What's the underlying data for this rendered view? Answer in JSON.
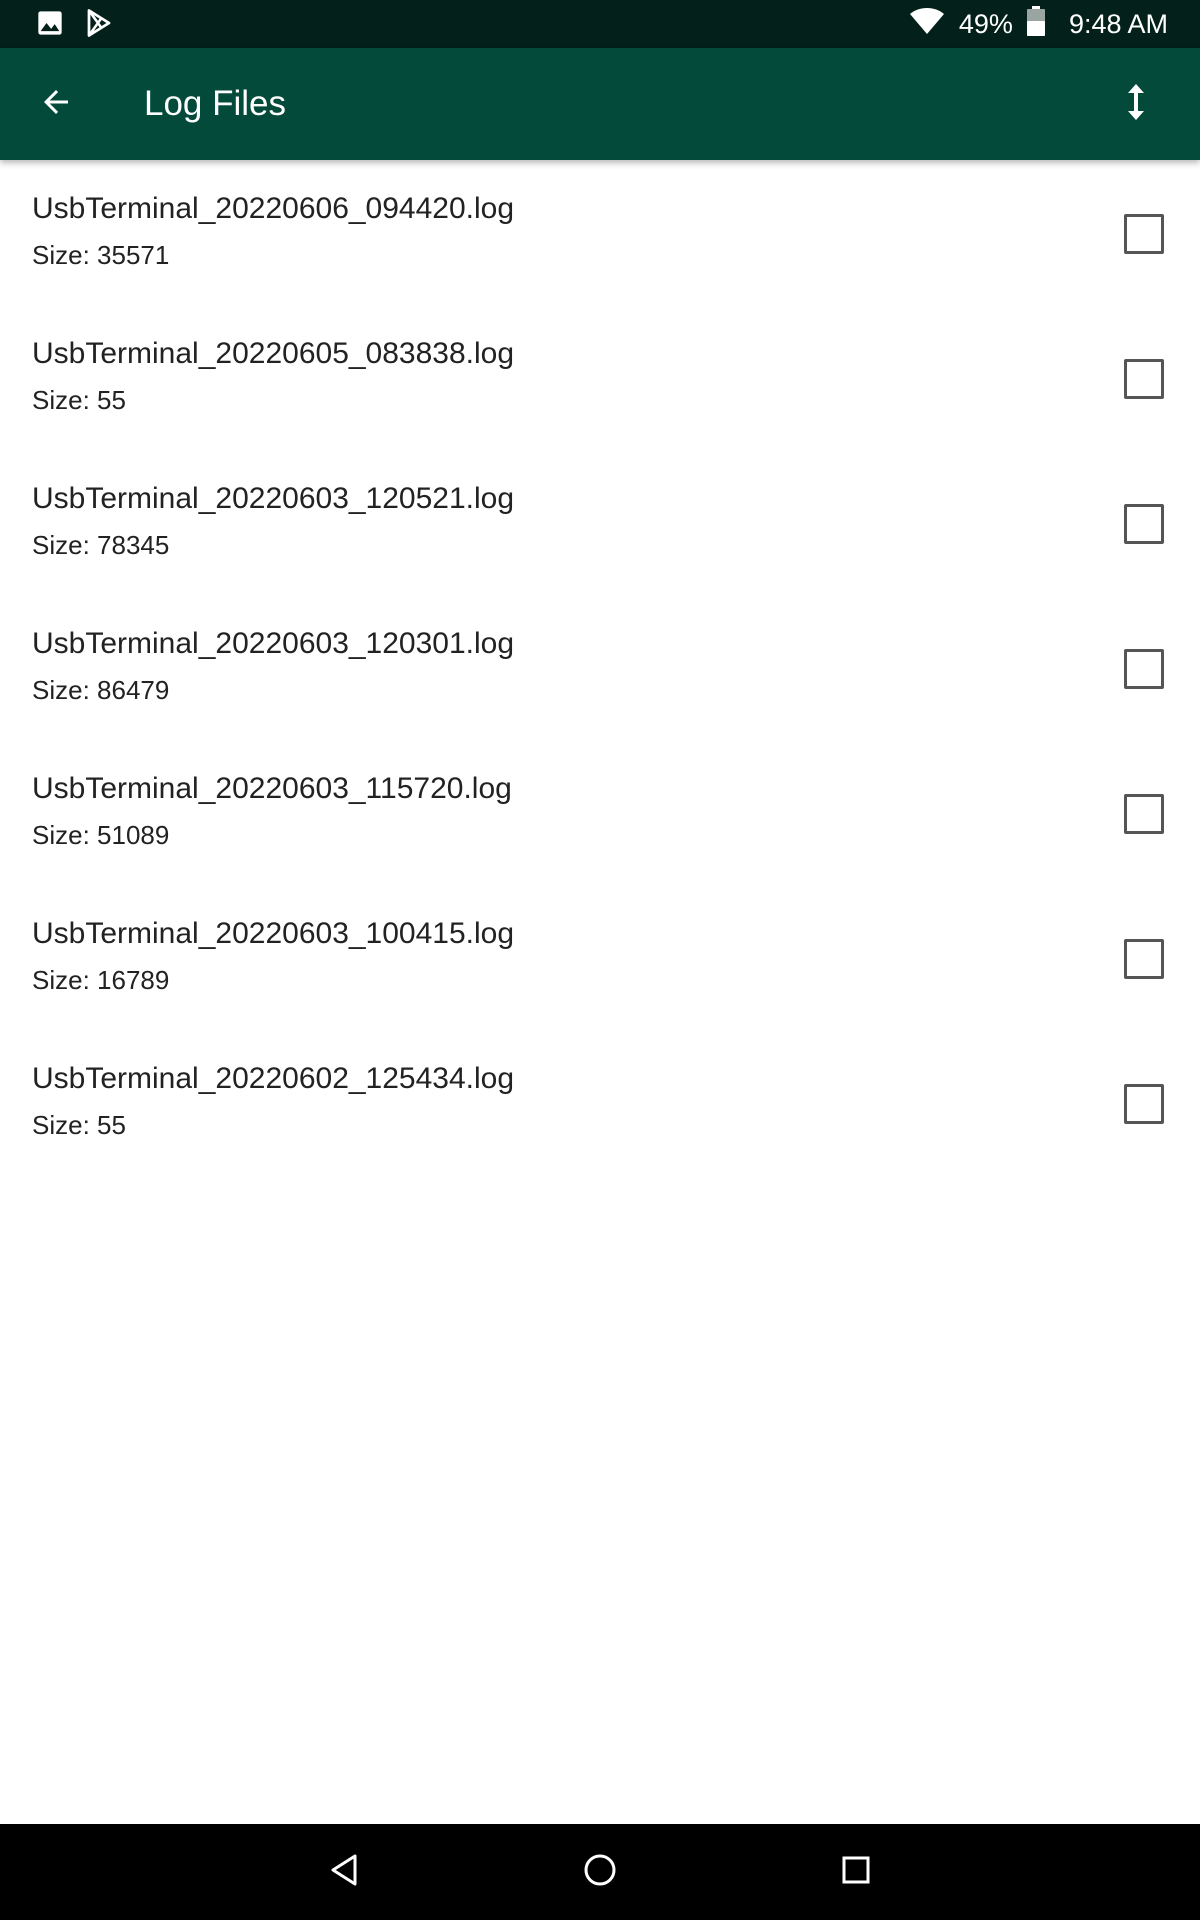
{
  "status_bar": {
    "battery_percent": "49%",
    "time": "9:48 AM",
    "icons": [
      "image-notification-icon",
      "play-store-icon",
      "wifi-icon",
      "battery-icon"
    ]
  },
  "app_bar": {
    "title": "Log Files",
    "back_icon": "arrow-back-icon",
    "sort_icon": "vertical-arrows-icon",
    "color": "#034a3b"
  },
  "files": [
    {
      "name": "UsbTerminal_20220606_094420.log",
      "size": "Size: 35571",
      "checked": false
    },
    {
      "name": "UsbTerminal_20220605_083838.log",
      "size": "Size: 55",
      "checked": false
    },
    {
      "name": "UsbTerminal_20220603_120521.log",
      "size": "Size: 78345",
      "checked": false
    },
    {
      "name": "UsbTerminal_20220603_120301.log",
      "size": "Size: 86479",
      "checked": false
    },
    {
      "name": "UsbTerminal_20220603_115720.log",
      "size": "Size: 51089",
      "checked": false
    },
    {
      "name": "UsbTerminal_20220603_100415.log",
      "size": "Size: 16789",
      "checked": false
    },
    {
      "name": "UsbTerminal_20220602_125434.log",
      "size": "Size: 55",
      "checked": false
    }
  ],
  "nav_bar": {
    "icons": [
      "nav-back-icon",
      "nav-home-icon",
      "nav-recents-icon"
    ]
  }
}
